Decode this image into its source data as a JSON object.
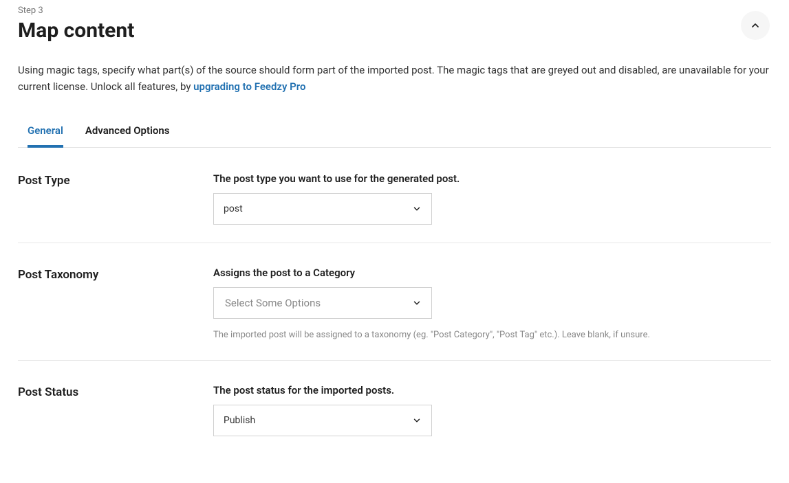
{
  "step": "Step 3",
  "title": "Map content",
  "description_text": "Using magic tags, specify what part(s) of the source should form part of the imported post. The magic tags that are greyed out and disabled, are unavailable for your current license. Unlock all features, by ",
  "description_link": "upgrading to Feedzy Pro",
  "tabs": {
    "general": "General",
    "advanced": "Advanced Options"
  },
  "fields": {
    "post_type": {
      "label": "Post Type",
      "description": "The post type you want to use for the generated post.",
      "value": "post"
    },
    "post_taxonomy": {
      "label": "Post Taxonomy",
      "description": "Assigns the post to a Category",
      "placeholder": "Select Some Options",
      "hint": "The imported post will be assigned to a taxonomy (eg. \"Post Category\", \"Post Tag\" etc.). Leave blank, if unsure."
    },
    "post_status": {
      "label": "Post Status",
      "description": "The post status for the imported posts.",
      "value": "Publish"
    }
  }
}
